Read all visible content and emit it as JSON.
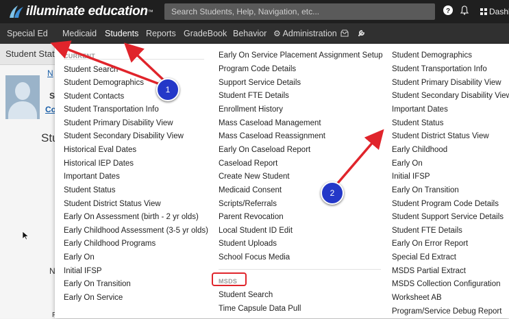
{
  "topbar": {
    "logo_text": "illuminate education",
    "logo_tm": "™",
    "search_placeholder": "Search Students, Help, Navigation, etc...",
    "dashboard_label": "Dashb",
    "help_icon": "question-circle-icon",
    "bell_icon": "bell-icon",
    "grid_icon": "grid-icon"
  },
  "navbar": {
    "items": [
      {
        "label": "Special Ed"
      },
      {
        "label": "Medicaid"
      },
      {
        "label": "Students"
      },
      {
        "label": "Reports"
      },
      {
        "label": "GradeBook"
      },
      {
        "label": "Behavior"
      },
      {
        "label": "Administration"
      }
    ],
    "inbox_icon": "inbox-icon",
    "wrench_icon": "wrench-icon"
  },
  "background": {
    "subbar_text": "Student Statu",
    "link_n": "N",
    "text_s": "S",
    "link_co": "Co",
    "title": "Stu",
    "text_n": "N",
    "text_f": "F"
  },
  "dropdown": {
    "col1": {
      "heading": "CURRENT",
      "items": [
        "Student Search",
        "Student Demographics",
        "Student Contacts",
        "Student Transportation Info",
        "Student Primary Disability View",
        "Student Secondary Disability View",
        "Historical Eval Dates",
        "Historical IEP Dates",
        "Important Dates",
        "Student Status",
        "Student District Status View",
        "Early On Assessment (birth - 2 yr olds)",
        "Early Childhood Assessment (3-5 yr olds)",
        "Early Childhood Programs",
        "Early On",
        "Initial IFSP",
        "Early On Transition",
        "Early On Service"
      ]
    },
    "col2": {
      "items": [
        "Early On Service Placement Assignment Setup",
        "Program Code Details",
        "Support Service Details",
        "Student FTE Details",
        "Enrollment History",
        "Mass Caseload Management",
        "Mass Caseload Reassignment",
        "Early On Caseload Report",
        "Caseload Report",
        "Create New Student",
        "Medicaid Consent",
        "Scripts/Referrals",
        "Parent Revocation",
        "Local Student ID Edit",
        "Student Uploads",
        "School Focus Media"
      ],
      "msds_heading": "MSDS",
      "msds_items": [
        "Student Search",
        "Time Capsule Data Pull"
      ]
    },
    "col3": {
      "items": [
        "Student Demographics",
        "Student Transportation Info",
        "Student Primary Disability View",
        "Student Secondary Disability View",
        "Important Dates",
        "Student Status",
        "Student District Status View",
        "Early Childhood",
        "Early On",
        "Initial IFSP",
        "Early On Transition",
        "Student Program Code Details",
        "Student Support Service Details",
        "Student FTE Details",
        "Early On Error Report",
        "Special Ed Extract",
        "MSDS Partial Extract",
        "MSDS Collection Configuration",
        "Worksheet AB",
        "Program/Service Debug Report"
      ]
    }
  },
  "callouts": [
    {
      "number": "1"
    },
    {
      "number": "2"
    }
  ],
  "colors": {
    "annotation_red": "#e0242b",
    "callout_blue": "#2438c8"
  }
}
